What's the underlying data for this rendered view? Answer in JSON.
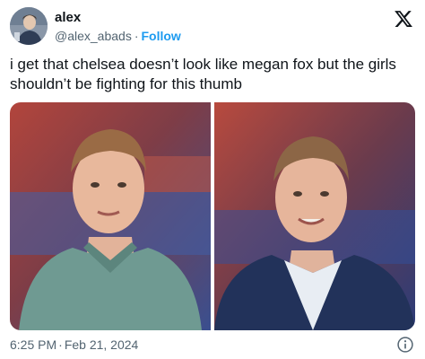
{
  "tweet": {
    "display_name": "alex",
    "handle": "@alex_abads",
    "separator": "·",
    "follow_label": "Follow",
    "text": "i get that chelsea doesn’t look like megan fox but the girls shouldn’t be fighting for this thumb",
    "time": "6:25 PM",
    "date": "Feb 21, 2024"
  },
  "icons": {
    "brand": "x-logo-icon",
    "info": "info-icon"
  },
  "colors": {
    "follow": "#1d9bf0",
    "secondary_text": "#536471",
    "primary_text": "#0f1419"
  }
}
